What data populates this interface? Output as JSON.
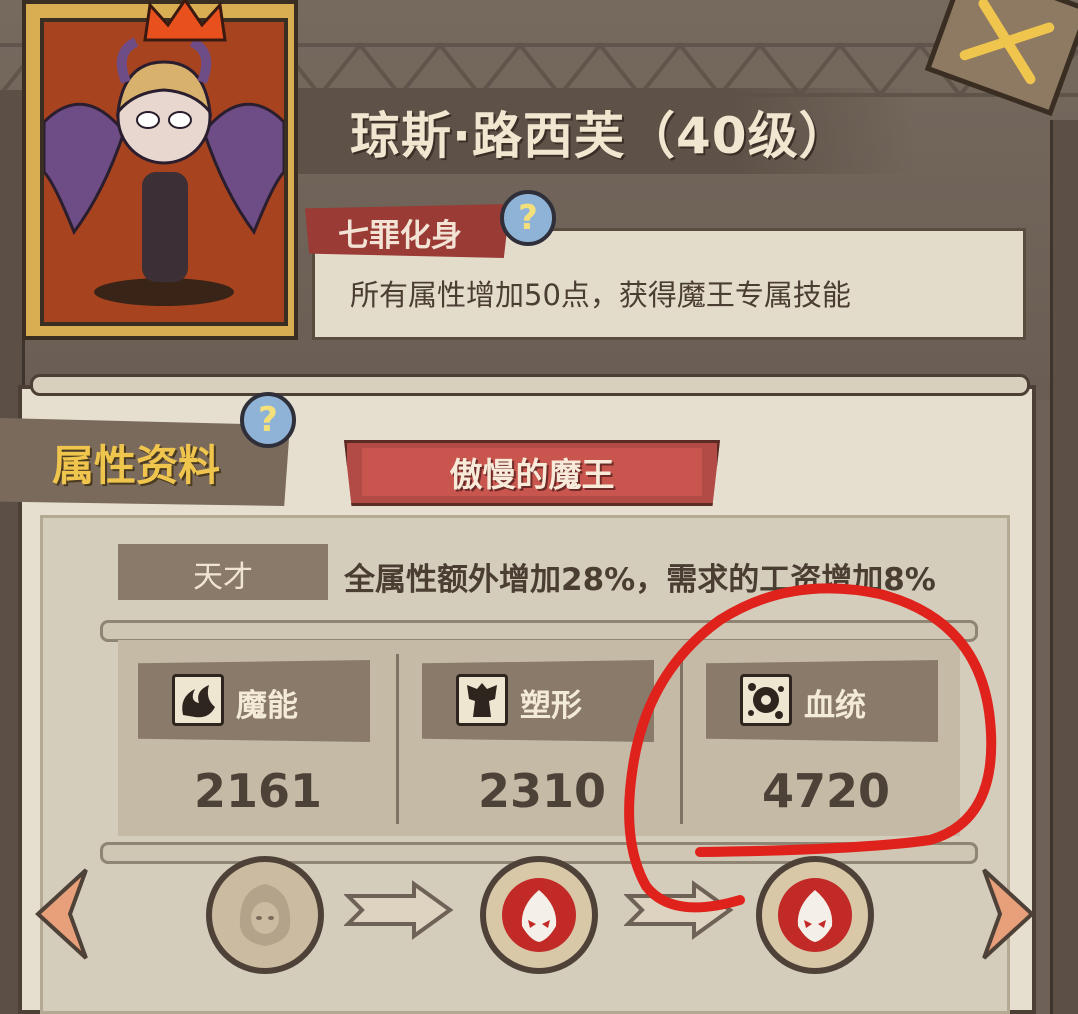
{
  "character": {
    "name": "琼斯·路西芙（40级）"
  },
  "trait": {
    "name": "七罪化身",
    "description": "所有属性增加50点，获得魔王专属技能"
  },
  "section": {
    "title": "属性资料",
    "class_name": "傲慢的魔王"
  },
  "talent": {
    "label": "天才",
    "description": "全属性额外增加28%，需求的工资增加8%"
  },
  "stats": [
    {
      "name": "魔能",
      "value": "2161",
      "icon": "magic-power-icon"
    },
    {
      "name": "塑形",
      "value": "2310",
      "icon": "physique-icon"
    },
    {
      "name": "血统",
      "value": "4720",
      "icon": "bloodline-icon"
    }
  ],
  "help_glyph": "?",
  "colors": {
    "title_gold": "#f0c54e",
    "ribbon_red": "#b24a45",
    "annotation_red": "#e0221c"
  }
}
